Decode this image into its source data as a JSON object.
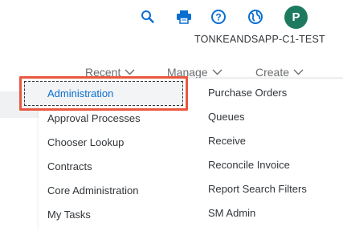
{
  "header": {
    "icons": [
      "search-icon",
      "print-icon",
      "help-icon",
      "globe-icon"
    ],
    "avatar_initial": "P",
    "system_name": "TONKEANDSAPP-C1-TEST"
  },
  "nav": {
    "recent": "Recent",
    "manage": "Manage",
    "create": "Create"
  },
  "menu": {
    "left_items": [
      "Administration",
      "Approval Processes",
      "Chooser Lookup",
      "Contracts",
      "Core Administration",
      "My Tasks"
    ],
    "right_items": [
      "Purchase Orders",
      "Queues",
      "Receive",
      "Reconcile Invoice",
      "Report Search Filters",
      "SM Admin"
    ],
    "selected_item": "Administration"
  },
  "colors": {
    "accent": "#0a6ed1",
    "avatar_bg": "#1d7a5f",
    "highlight_border": "#e9573f",
    "text": "#32363a"
  }
}
